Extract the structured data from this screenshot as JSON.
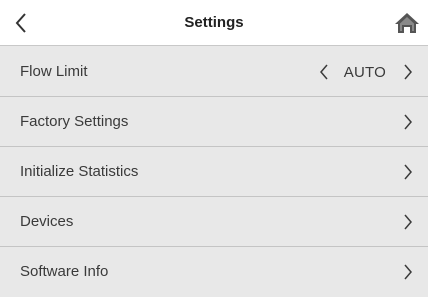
{
  "header": {
    "title": "Settings",
    "back_icon": "chevron-left-icon",
    "home_icon": "home-icon"
  },
  "rows": [
    {
      "label": "Flow Limit",
      "value": "AUTO",
      "icon": "chevron-right-icon"
    },
    {
      "label": "Factory Settings",
      "icon": "chevron-right-icon"
    },
    {
      "label": "Initialize Statistics",
      "icon": "chevron-right-icon"
    },
    {
      "label": "Devices",
      "icon": "chevron-right-icon"
    },
    {
      "label": "Software Info",
      "icon": "chevron-right-icon"
    }
  ],
  "colors": {
    "header_bg": "#ffffff",
    "list_bg": "#e8e8e8",
    "divider": "#c4c4c4",
    "text": "#3a3a3a"
  }
}
